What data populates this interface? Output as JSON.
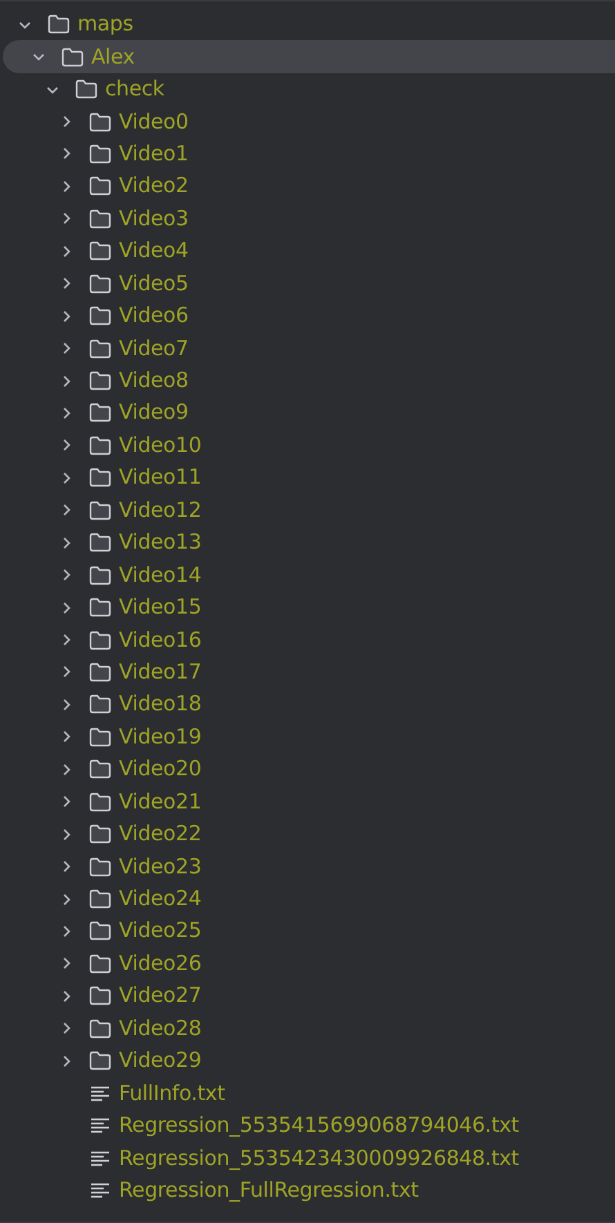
{
  "tree": [
    {
      "name": "maps",
      "kind": "folder",
      "expanded": true,
      "selected": false,
      "children": [
        {
          "name": "Alex",
          "kind": "folder",
          "expanded": true,
          "selected": true,
          "children": [
            {
              "name": "check",
              "kind": "folder",
              "expanded": true,
              "selected": false,
              "children": [
                {
                  "name": "Video0",
                  "kind": "folder",
                  "expanded": false,
                  "selected": false
                },
                {
                  "name": "Video1",
                  "kind": "folder",
                  "expanded": false,
                  "selected": false
                },
                {
                  "name": "Video2",
                  "kind": "folder",
                  "expanded": false,
                  "selected": false
                },
                {
                  "name": "Video3",
                  "kind": "folder",
                  "expanded": false,
                  "selected": false
                },
                {
                  "name": "Video4",
                  "kind": "folder",
                  "expanded": false,
                  "selected": false
                },
                {
                  "name": "Video5",
                  "kind": "folder",
                  "expanded": false,
                  "selected": false
                },
                {
                  "name": "Video6",
                  "kind": "folder",
                  "expanded": false,
                  "selected": false
                },
                {
                  "name": "Video7",
                  "kind": "folder",
                  "expanded": false,
                  "selected": false
                },
                {
                  "name": "Video8",
                  "kind": "folder",
                  "expanded": false,
                  "selected": false
                },
                {
                  "name": "Video9",
                  "kind": "folder",
                  "expanded": false,
                  "selected": false
                },
                {
                  "name": "Video10",
                  "kind": "folder",
                  "expanded": false,
                  "selected": false
                },
                {
                  "name": "Video11",
                  "kind": "folder",
                  "expanded": false,
                  "selected": false
                },
                {
                  "name": "Video12",
                  "kind": "folder",
                  "expanded": false,
                  "selected": false
                },
                {
                  "name": "Video13",
                  "kind": "folder",
                  "expanded": false,
                  "selected": false
                },
                {
                  "name": "Video14",
                  "kind": "folder",
                  "expanded": false,
                  "selected": false
                },
                {
                  "name": "Video15",
                  "kind": "folder",
                  "expanded": false,
                  "selected": false
                },
                {
                  "name": "Video16",
                  "kind": "folder",
                  "expanded": false,
                  "selected": false
                },
                {
                  "name": "Video17",
                  "kind": "folder",
                  "expanded": false,
                  "selected": false
                },
                {
                  "name": "Video18",
                  "kind": "folder",
                  "expanded": false,
                  "selected": false
                },
                {
                  "name": "Video19",
                  "kind": "folder",
                  "expanded": false,
                  "selected": false
                },
                {
                  "name": "Video20",
                  "kind": "folder",
                  "expanded": false,
                  "selected": false
                },
                {
                  "name": "Video21",
                  "kind": "folder",
                  "expanded": false,
                  "selected": false
                },
                {
                  "name": "Video22",
                  "kind": "folder",
                  "expanded": false,
                  "selected": false
                },
                {
                  "name": "Video23",
                  "kind": "folder",
                  "expanded": false,
                  "selected": false
                },
                {
                  "name": "Video24",
                  "kind": "folder",
                  "expanded": false,
                  "selected": false
                },
                {
                  "name": "Video25",
                  "kind": "folder",
                  "expanded": false,
                  "selected": false
                },
                {
                  "name": "Video26",
                  "kind": "folder",
                  "expanded": false,
                  "selected": false
                },
                {
                  "name": "Video27",
                  "kind": "folder",
                  "expanded": false,
                  "selected": false
                },
                {
                  "name": "Video28",
                  "kind": "folder",
                  "expanded": false,
                  "selected": false
                },
                {
                  "name": "Video29",
                  "kind": "folder",
                  "expanded": false,
                  "selected": false
                },
                {
                  "name": "FullInfo.txt",
                  "kind": "file",
                  "selected": false
                },
                {
                  "name": "Regression_5535415699068794046.txt",
                  "kind": "file",
                  "selected": false
                },
                {
                  "name": "Regression_5535423430009926848.txt",
                  "kind": "file",
                  "selected": false
                },
                {
                  "name": "Regression_FullRegression.txt",
                  "kind": "file",
                  "selected": false
                }
              ]
            }
          ]
        }
      ]
    }
  ]
}
